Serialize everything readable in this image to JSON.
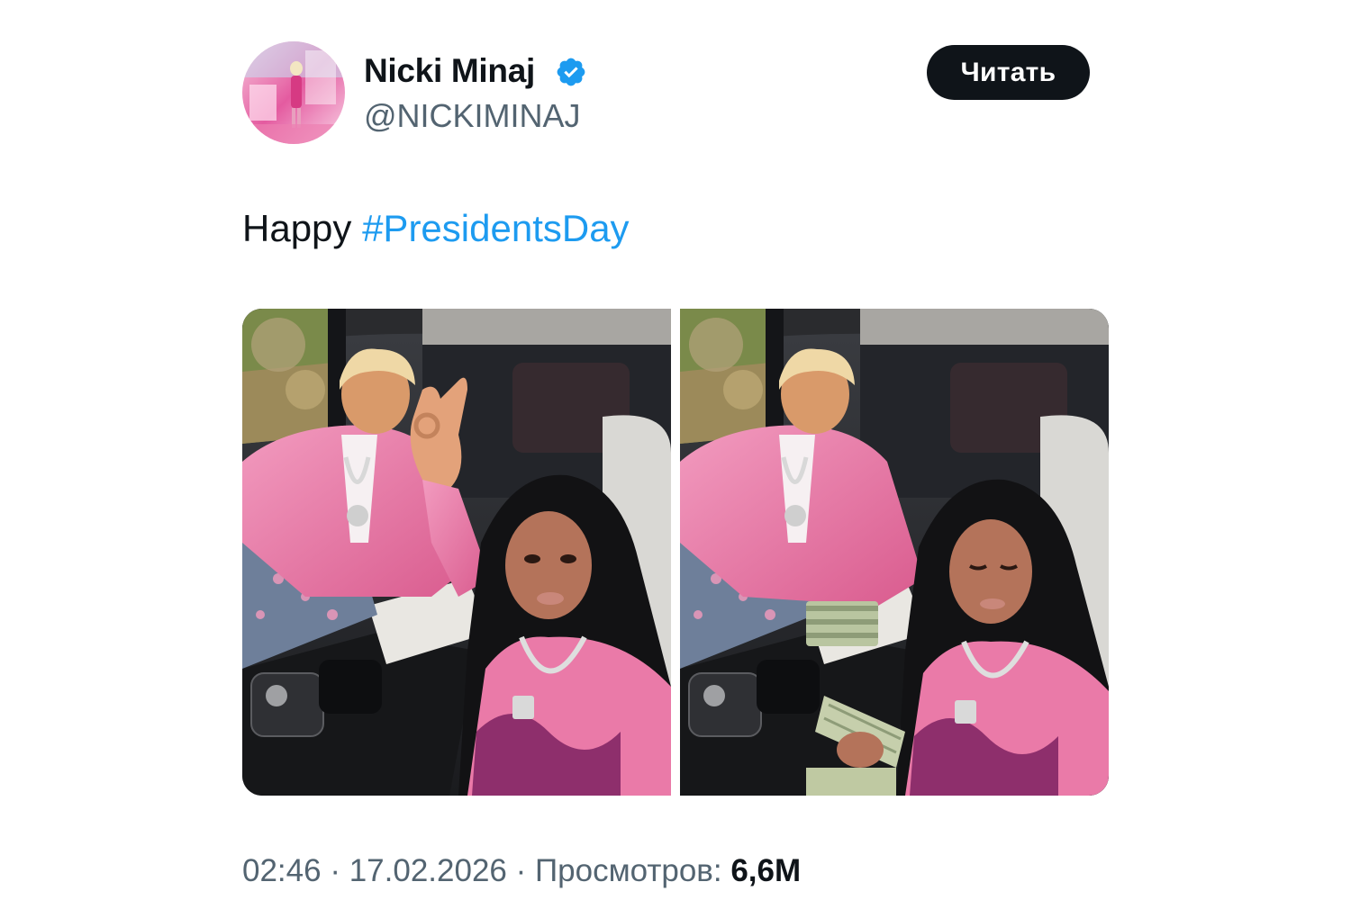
{
  "author": {
    "name": "Nicki Minaj",
    "handle": "@NICKIMINAJ",
    "verified": true
  },
  "follow_button": {
    "label": "Читать"
  },
  "tweet": {
    "text_prefix": "Happy ",
    "hashtag": "#PresidentsDay"
  },
  "media": {
    "photos": [
      {
        "description": "photo-1"
      },
      {
        "description": "photo-2"
      }
    ]
  },
  "meta": {
    "time": "02:46",
    "separator": " · ",
    "date": "17.02.2026",
    "views_label": "Просмотров:",
    "views_count": "6,6M"
  },
  "colors": {
    "text": "#0f1419",
    "secondary": "#536471",
    "link": "#1d9bf0",
    "button_bg": "#0f1419",
    "verified": "#1d9bf0"
  }
}
